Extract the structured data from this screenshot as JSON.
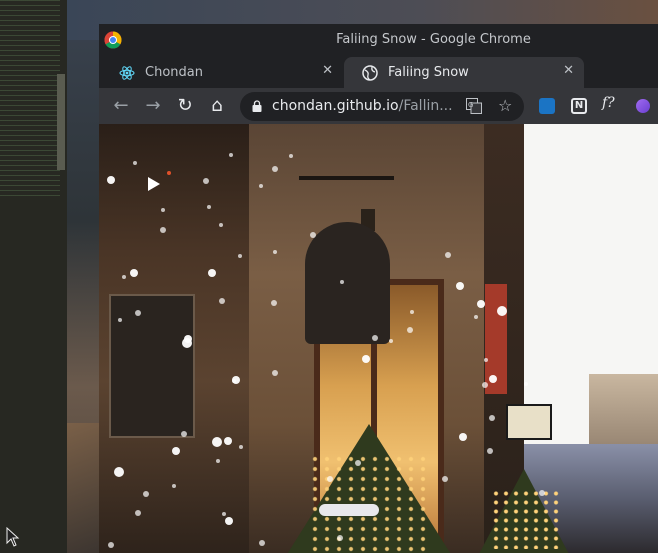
{
  "browser": {
    "window_title": "Faliing Snow - Google Chrome",
    "tabs": [
      {
        "label": "Chondan",
        "icon": "react-icon",
        "active": false
      },
      {
        "label": "Faliing Snow",
        "icon": "globe-icon",
        "active": true
      }
    ],
    "close_glyph": "✕",
    "new_tab_glyph": "+",
    "url_domain": "chondan.github.io",
    "url_path": "/Fallin..."
  },
  "toolbar": {
    "back_glyph": "←",
    "forward_glyph": "→",
    "reload_glyph": "↻",
    "home_glyph": "⌂",
    "star_glyph": "☆",
    "ext_notion": "N",
    "ext_fx": "f?"
  },
  "page": {
    "description_icons": [
      "play-icon",
      "record-dot-icon"
    ]
  },
  "colors": {
    "chrome_dark": "#202124",
    "toolbar": "#35363a",
    "text": "#e8eaed"
  }
}
